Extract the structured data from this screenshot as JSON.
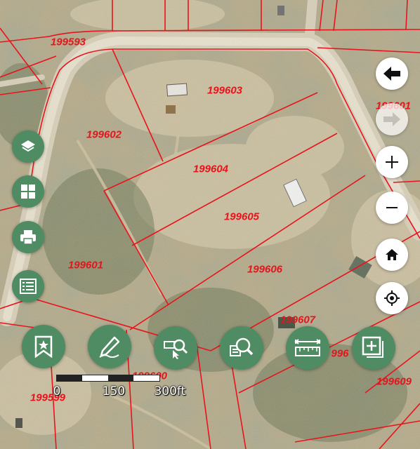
{
  "map": {
    "parcels": [
      {
        "id": "199593",
        "label": "199593"
      },
      {
        "id": "199603",
        "label": "199603"
      },
      {
        "id": "199601-top",
        "label": "199601"
      },
      {
        "id": "199602",
        "label": "199602"
      },
      {
        "id": "199604",
        "label": "199604"
      },
      {
        "id": "199605",
        "label": "199605"
      },
      {
        "id": "199601",
        "label": "199601"
      },
      {
        "id": "199606",
        "label": "199606"
      },
      {
        "id": "199607",
        "label": "199607"
      },
      {
        "id": "1996xx-partial",
        "label": "996"
      },
      {
        "id": "199600",
        "label": "199600"
      },
      {
        "id": "199609",
        "label": "199609"
      },
      {
        "id": "199599",
        "label": "199599"
      }
    ],
    "parcel_line_color": "#e8141c",
    "parcel_label_color": "#e8141c"
  },
  "scale": {
    "labels": [
      "0",
      "150",
      "300ft"
    ]
  },
  "colors": {
    "button_green": "#4f8c63",
    "button_white": "#ffffff"
  },
  "left_tools": [
    {
      "name": "layers-icon"
    },
    {
      "name": "basemap-grid-icon"
    },
    {
      "name": "print-icon"
    },
    {
      "name": "list-icon"
    }
  ],
  "bottom_tools": [
    {
      "name": "bookmark-icon"
    },
    {
      "name": "draw-icon"
    },
    {
      "name": "identify-icon"
    },
    {
      "name": "search-icon"
    },
    {
      "name": "measure-icon"
    },
    {
      "name": "add-data-icon"
    }
  ],
  "nav_tools": [
    {
      "name": "back-arrow-icon"
    },
    {
      "name": "forward-arrow-icon"
    },
    {
      "name": "zoom-in-icon"
    },
    {
      "name": "zoom-out-icon"
    },
    {
      "name": "home-icon"
    },
    {
      "name": "locate-icon"
    }
  ]
}
